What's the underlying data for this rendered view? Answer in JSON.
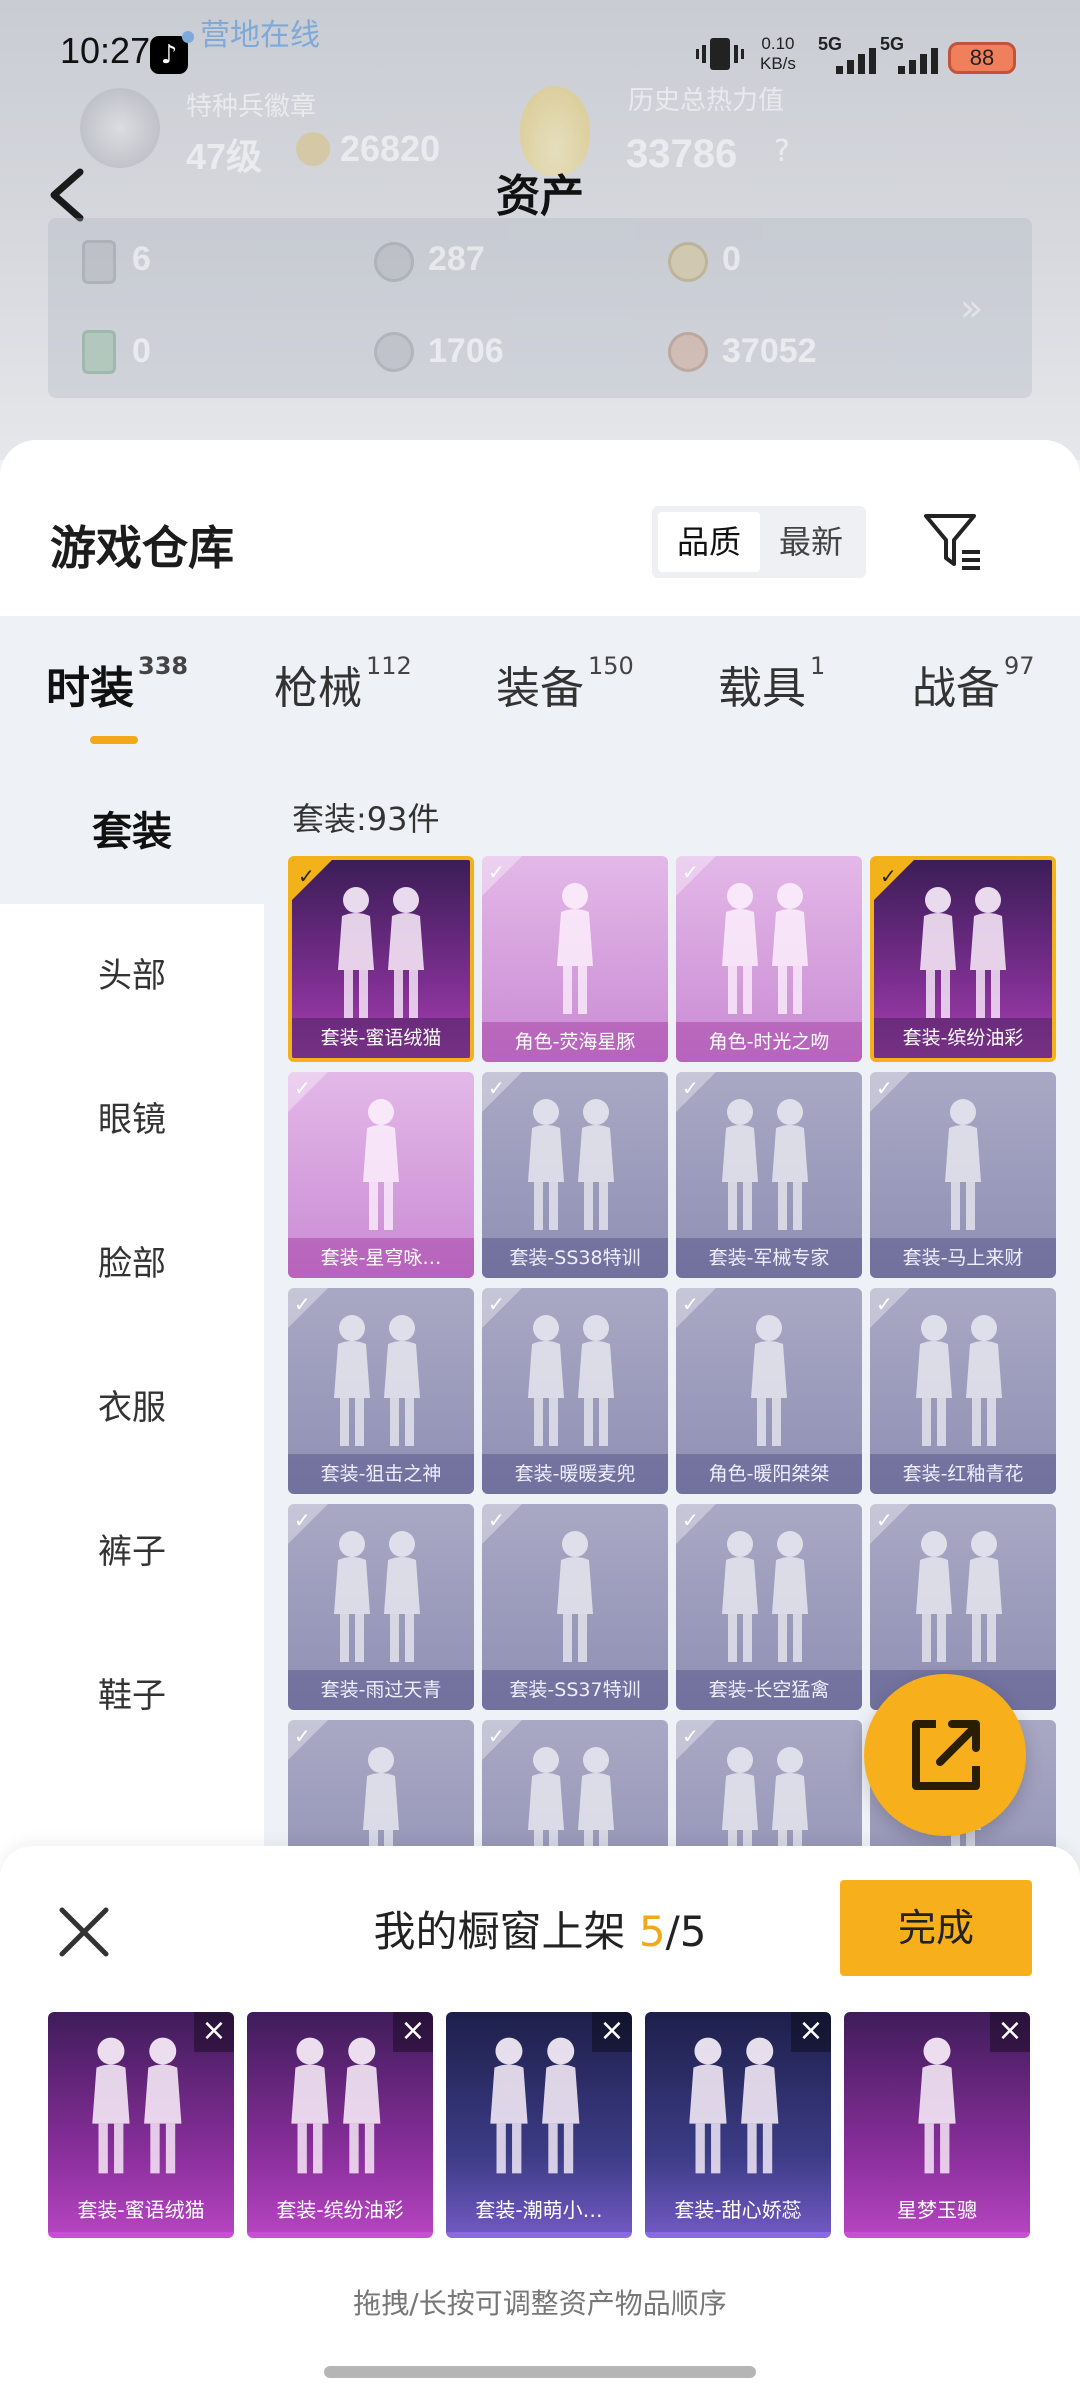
{
  "status_bar": {
    "time": "10:27",
    "camp_status": "营地在线",
    "net_speed_value": "0.10",
    "net_speed_unit": "KB/s",
    "sim1": "5G",
    "sim2": "5G",
    "battery": "88"
  },
  "header": {
    "label_left": "特种兵徽章",
    "level": "47级",
    "points": "26820",
    "label_right": "历史总热力值",
    "heat_value": "33786",
    "help_mark": "?",
    "title": "资产"
  },
  "currencies": [
    {
      "icon": "card-icon",
      "value": "6"
    },
    {
      "icon": "silver-coin-icon",
      "value": "287"
    },
    {
      "icon": "gold-coin-icon",
      "value": "0"
    },
    {
      "icon": "green-card-icon",
      "value": "0"
    },
    {
      "icon": "token-icon",
      "value": "1706"
    },
    {
      "icon": "bronze-coin-icon",
      "value": "37052"
    }
  ],
  "expand_symbol": "»",
  "warehouse": {
    "title": "游戏仓库",
    "sort_options": [
      "品质",
      "最新"
    ],
    "tabs": [
      {
        "label": "时装",
        "count": "338"
      },
      {
        "label": "枪械",
        "count": "112"
      },
      {
        "label": "装备",
        "count": "150"
      },
      {
        "label": "载具",
        "count": "1"
      },
      {
        "label": "战备",
        "count": "97"
      }
    ],
    "side_nav": [
      "套装",
      "头部",
      "眼镜",
      "脸部",
      "衣服",
      "裤子",
      "鞋子"
    ],
    "grid_header": "套装:93件",
    "items": [
      {
        "name": "套装-蜜语绒猫",
        "style": "owned"
      },
      {
        "name": "角色-荧海星豚",
        "style": "purple"
      },
      {
        "name": "角色-时光之吻",
        "style": "purple"
      },
      {
        "name": "套装-缤纷油彩",
        "style": "owned"
      },
      {
        "name": "套装-星穹咏…",
        "style": "purple"
      },
      {
        "name": "套装-SS38特训",
        "style": "gray"
      },
      {
        "name": "套装-军械专家",
        "style": "gray"
      },
      {
        "name": "套装-马上来财",
        "style": "gray"
      },
      {
        "name": "套装-狙击之神",
        "style": "gray"
      },
      {
        "name": "套装-暖暖麦兜",
        "style": "gray"
      },
      {
        "name": "角色-暖阳桀桀",
        "style": "gray"
      },
      {
        "name": "套装-红釉青花",
        "style": "gray"
      },
      {
        "name": "套装-雨过天青",
        "style": "gray"
      },
      {
        "name": "套装-SS37特训",
        "style": "gray"
      },
      {
        "name": "套装-长空猛禽",
        "style": "gray"
      },
      {
        "name": "",
        "style": "gray"
      },
      {
        "name": "",
        "style": "gray"
      },
      {
        "name": "",
        "style": "gray"
      },
      {
        "name": "",
        "style": "gray"
      },
      {
        "name": "",
        "style": "gray"
      }
    ]
  },
  "showcase": {
    "title": "我的橱窗上架",
    "count_current": "5",
    "count_total": "/5",
    "done_label": "完成",
    "remove_symbol": "×",
    "slots": [
      {
        "name": "套装-蜜语绒猫",
        "style": "purple"
      },
      {
        "name": "套装-缤纷油彩",
        "style": "purple"
      },
      {
        "name": "套装-潮萌小…",
        "style": "indigo"
      },
      {
        "name": "套装-甜心娇蕊",
        "style": "indigo"
      },
      {
        "name": "星梦玉骢",
        "style": "purple"
      }
    ],
    "hint": "拖拽/长按可调整资产物品顺序"
  },
  "colors": {
    "accent": "#f7b01b",
    "owned_border": "#f3b21a",
    "camp_online": "#7ea9d8"
  }
}
